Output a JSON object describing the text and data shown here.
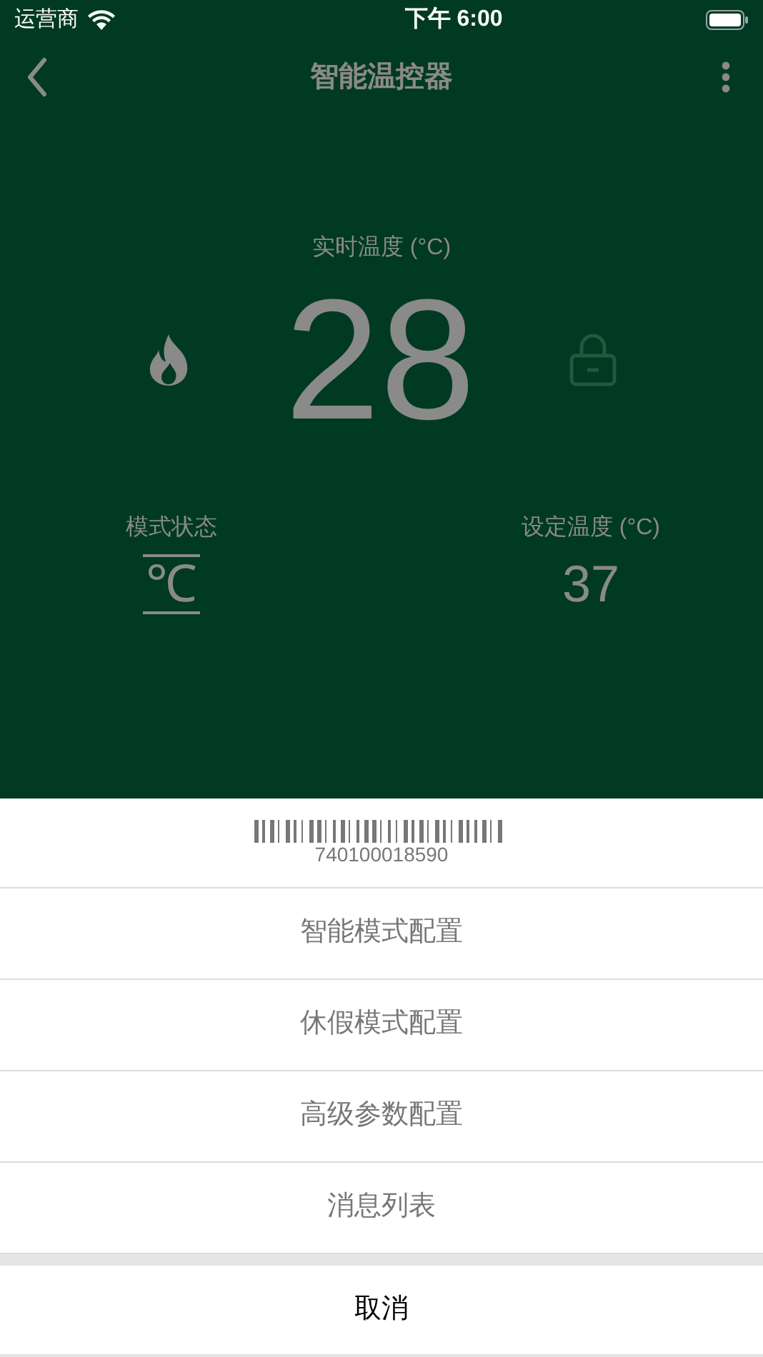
{
  "status_bar": {
    "carrier": "运营商",
    "time": "下午 6:00"
  },
  "nav": {
    "title": "智能温控器"
  },
  "current": {
    "label": "实时温度 (°C)",
    "value": "28",
    "heating": true,
    "locked": false
  },
  "mode": {
    "label": "模式状态",
    "value": "℃"
  },
  "setpoint": {
    "label": "设定温度 (°C)",
    "value": "37"
  },
  "sheet": {
    "barcode": "740100018590",
    "items": [
      "智能模式配置",
      "休假模式配置",
      "高级参数配置",
      "消息列表"
    ],
    "cancel": "取消"
  }
}
